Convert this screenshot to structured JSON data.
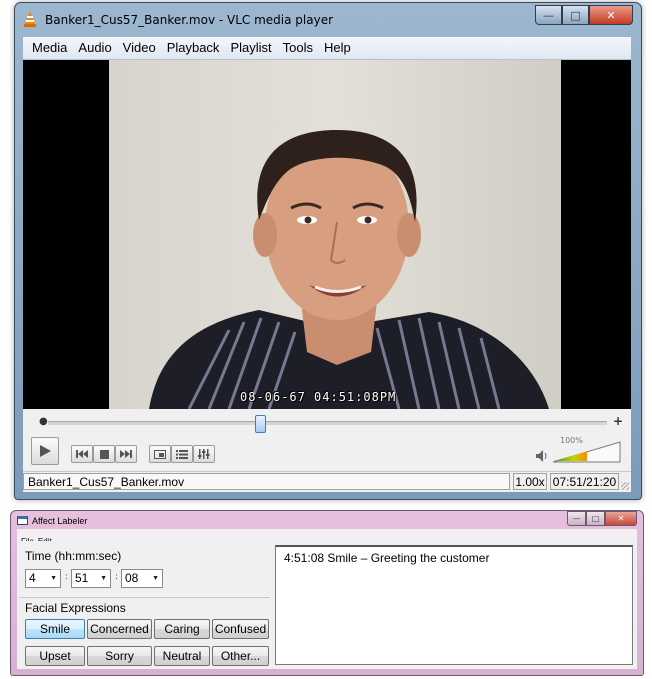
{
  "vlc": {
    "window_title": "Banker1_Cus57_Banker.mov - VLC media player",
    "menu": [
      "Media",
      "Audio",
      "Video",
      "Playback",
      "Playlist",
      "Tools",
      "Help"
    ],
    "video_overlay": "08-06-67  04:51:08PM",
    "seek_position": 0.38,
    "volume_label": "100%",
    "volume_level": 0.5,
    "status": {
      "filename": "Banker1_Cus57_Banker.mov",
      "rate": "1.00x",
      "time": "07:51/21:20"
    },
    "icons": [
      "vlc-cone-icon",
      "play-icon",
      "previous-icon",
      "stop-icon",
      "next-icon",
      "fullscreen-icon",
      "playlist-icon",
      "extended-settings-icon",
      "speaker-icon"
    ]
  },
  "labeler": {
    "window_title": "Affect Labeler",
    "menu": [
      "File",
      "Edit"
    ],
    "time_label": "Time (hh:mm:sec)",
    "hours": "4",
    "minutes": "51",
    "seconds": "08",
    "expressions_label": "Facial Expressions",
    "buttons": [
      "Smile",
      "Concerned",
      "Caring",
      "Confused",
      "Upset",
      "Sorry",
      "Neutral",
      "Other..."
    ],
    "log_entry": "4:51:08 Smile – Greeting the customer"
  }
}
